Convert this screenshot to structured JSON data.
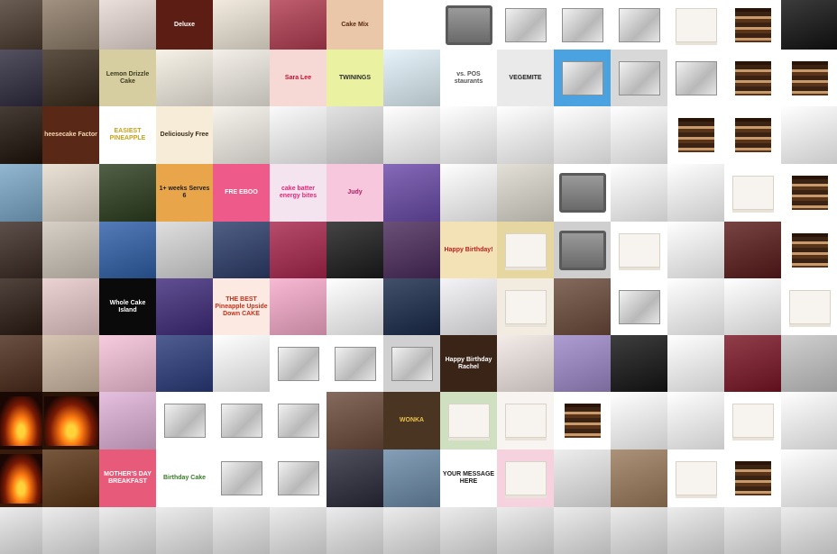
{
  "tiles": [
    {
      "bg": "#4a3a2e",
      "kind": "photo"
    },
    {
      "bg": "#8c7a66",
      "kind": "photo"
    },
    {
      "bg": "#e7d9d3",
      "kind": "photo"
    },
    {
      "bg": "#5c1e14",
      "kind": "text",
      "text": "Deluxe",
      "color": "#ffffff"
    },
    {
      "bg": "#efe6d7",
      "kind": "photo"
    },
    {
      "bg": "#b13b50",
      "kind": "photo"
    },
    {
      "bg": "#e9c7a8",
      "kind": "text",
      "text": "Cake Mix",
      "color": "#5a2a12"
    },
    {
      "bg": "#ffffff",
      "kind": "pan-outline"
    },
    {
      "bg": "#ffffff",
      "kind": "pan-square"
    },
    {
      "bg": "#ffffff",
      "kind": "pan-silver"
    },
    {
      "bg": "#ffffff",
      "kind": "pan-silver"
    },
    {
      "bg": "#ffffff",
      "kind": "pan-silver"
    },
    {
      "bg": "#ffffff",
      "kind": "cake-white"
    },
    {
      "bg": "#ffffff",
      "kind": "cake-layer"
    },
    {
      "bg": "#111111",
      "kind": "photo"
    },
    {
      "bg": "#2e2a3d",
      "kind": "photo"
    },
    {
      "bg": "#3a2b1c",
      "kind": "photo"
    },
    {
      "bg": "#d6cda0",
      "kind": "text",
      "text": "Lemon Drizzle Cake",
      "color": "#3c3c1e"
    },
    {
      "bg": "#f5efe3",
      "kind": "photo"
    },
    {
      "bg": "#f1ece4",
      "kind": "photo"
    },
    {
      "bg": "#f6d9d4",
      "kind": "text",
      "text": "Sara Lee",
      "color": "#c8102e"
    },
    {
      "bg": "#eaf2a2",
      "kind": "text",
      "text": "TWININGS",
      "color": "#2a2a2a"
    },
    {
      "bg": "#e0f0f8",
      "kind": "photo"
    },
    {
      "bg": "#ffffff",
      "kind": "text",
      "text": "vs. POS\nstaurants",
      "color": "#555555"
    },
    {
      "bg": "#eaeaea",
      "kind": "text",
      "text": "VEGEMITE",
      "color": "#222222"
    },
    {
      "bg": "#4aa3e0",
      "kind": "pan-silver"
    },
    {
      "bg": "#d8d8d8",
      "kind": "pan-silver"
    },
    {
      "bg": "#ffffff",
      "kind": "pan-silver"
    },
    {
      "bg": "#ffffff",
      "kind": "cake-layer"
    },
    {
      "bg": "#ffffff",
      "kind": "cake-layer"
    },
    {
      "bg": "#1e120a",
      "kind": "photo"
    },
    {
      "bg": "#5a2817",
      "kind": "text",
      "text": "heesecake Factor",
      "color": "#f4d7b0"
    },
    {
      "bg": "#ffffff",
      "kind": "text",
      "text": "EASIEST PINEAPPLE",
      "color": "#c8a21a"
    },
    {
      "bg": "#f6ecd7",
      "kind": "text",
      "text": "Deliciously Free",
      "color": "#3a2a1a"
    },
    {
      "bg": "#f5f1ea",
      "kind": "photo"
    },
    {
      "bg": "#f9f9f9",
      "kind": "photo"
    },
    {
      "bg": "#dcdcdc",
      "kind": "photo"
    },
    {
      "bg": "#ffffff",
      "kind": "photo"
    },
    {
      "bg": "#ffffff",
      "kind": "photo"
    },
    {
      "bg": "#ffffff",
      "kind": "photo"
    },
    {
      "bg": "#ffffff",
      "kind": "photo"
    },
    {
      "bg": "#ffffff",
      "kind": "photo"
    },
    {
      "bg": "#ffffff",
      "kind": "cake-layer"
    },
    {
      "bg": "#ffffff",
      "kind": "cake-layer"
    },
    {
      "bg": "#ffffff",
      "kind": "photo"
    },
    {
      "bg": "#7aa7c7",
      "kind": "photo"
    },
    {
      "bg": "#e6dccd",
      "kind": "photo"
    },
    {
      "bg": "#2b3d1e",
      "kind": "photo"
    },
    {
      "bg": "#e8a54a",
      "kind": "text",
      "text": "1+ weeks Serves 6",
      "color": "#222222"
    },
    {
      "bg": "#ee5a8a",
      "kind": "text",
      "text": "FRE EBOO",
      "color": "#ffffff"
    },
    {
      "bg": "#f4e4ef",
      "kind": "text",
      "text": "cake batter energy bites",
      "color": "#e8207a"
    },
    {
      "bg": "#f7c7dd",
      "kind": "text",
      "text": "Judy",
      "color": "#b01d6a"
    },
    {
      "bg": "#6a4aa8",
      "kind": "photo"
    },
    {
      "bg": "#ffffff",
      "kind": "photo"
    },
    {
      "bg": "#ddd9cf",
      "kind": "photo"
    },
    {
      "bg": "#ffffff",
      "kind": "pan-square"
    },
    {
      "bg": "#ffffff",
      "kind": "photo"
    },
    {
      "bg": "#ffffff",
      "kind": "photo"
    },
    {
      "bg": "#ffffff",
      "kind": "cake-white"
    },
    {
      "bg": "#ffffff",
      "kind": "cake-layer"
    },
    {
      "bg": "#3a2a24",
      "kind": "photo"
    },
    {
      "bg": "#cfc6bb",
      "kind": "photo"
    },
    {
      "bg": "#2f5fa8",
      "kind": "photo"
    },
    {
      "bg": "#d8d8d8",
      "kind": "photo"
    },
    {
      "bg": "#2c3c6a",
      "kind": "photo"
    },
    {
      "bg": "#a8254d",
      "kind": "photo"
    },
    {
      "bg": "#1b1b1b",
      "kind": "photo"
    },
    {
      "bg": "#4a2a5a",
      "kind": "photo"
    },
    {
      "bg": "#f3e2b5",
      "kind": "text",
      "text": "Happy Birthday!",
      "color": "#c21d1d"
    },
    {
      "bg": "#e6d7a0",
      "kind": "cake-white"
    },
    {
      "bg": "#cfcfcf",
      "kind": "pan-square"
    },
    {
      "bg": "#ffffff",
      "kind": "cake-white"
    },
    {
      "bg": "#ffffff",
      "kind": "photo"
    },
    {
      "bg": "#5a1a1a",
      "kind": "photo"
    },
    {
      "bg": "#ffffff",
      "kind": "cake-layer"
    },
    {
      "bg": "#2a1a12",
      "kind": "photo"
    },
    {
      "bg": "#e8c9c9",
      "kind": "photo"
    },
    {
      "bg": "#0a0a0a",
      "kind": "text",
      "text": "Whole Cake Island",
      "color": "#ffffff"
    },
    {
      "bg": "#3e2a7a",
      "kind": "photo"
    },
    {
      "bg": "#fbe9e2",
      "kind": "text",
      "text": "THE BEST Pineapple Upside Down CAKE",
      "color": "#c2341c"
    },
    {
      "bg": "#f6a9c9",
      "kind": "photo"
    },
    {
      "bg": "#ffffff",
      "kind": "photo"
    },
    {
      "bg": "#1a2a4a",
      "kind": "photo"
    },
    {
      "bg": "#f2f2f6",
      "kind": "photo"
    },
    {
      "bg": "#f2ece0",
      "kind": "cake-white"
    },
    {
      "bg": "#6a4a3a",
      "kind": "photo"
    },
    {
      "bg": "#ffffff",
      "kind": "pan-silver"
    },
    {
      "bg": "#ffffff",
      "kind": "photo"
    },
    {
      "bg": "#ffffff",
      "kind": "photo"
    },
    {
      "bg": "#ffffff",
      "kind": "cake-white"
    },
    {
      "bg": "#4a2a1a",
      "kind": "photo"
    },
    {
      "bg": "#cfb9a4",
      "kind": "photo"
    },
    {
      "bg": "#f5c1d8",
      "kind": "photo"
    },
    {
      "bg": "#2a3a7a",
      "kind": "photo"
    },
    {
      "bg": "#ffffff",
      "kind": "photo"
    },
    {
      "bg": "#ffffff",
      "kind": "pan-silver"
    },
    {
      "bg": "#ffffff",
      "kind": "pan-silver"
    },
    {
      "bg": "#d0d0d0",
      "kind": "pan-silver"
    },
    {
      "bg": "#3a2418",
      "kind": "text",
      "text": "Happy Birthday Rachel",
      "color": "#ffffff"
    },
    {
      "bg": "#f2e8e4",
      "kind": "photo"
    },
    {
      "bg": "#9c88c8",
      "kind": "photo"
    },
    {
      "bg": "#141414",
      "kind": "photo"
    },
    {
      "bg": "#ffffff",
      "kind": "photo"
    },
    {
      "bg": "#7a1424",
      "kind": "photo"
    },
    {
      "bg": "#c6c6c6",
      "kind": "photo"
    },
    {
      "bg": "#1a0804",
      "kind": "fire"
    },
    {
      "bg": "#2a1408",
      "kind": "fire"
    },
    {
      "bg": "#e0b2d8",
      "kind": "photo"
    },
    {
      "bg": "#ffffff",
      "kind": "pan-silver"
    },
    {
      "bg": "#ffffff",
      "kind": "pan-silver"
    },
    {
      "bg": "#ffffff",
      "kind": "pan-silver"
    },
    {
      "bg": "#6a4a3a",
      "kind": "photo"
    },
    {
      "bg": "#4a3422",
      "kind": "text",
      "text": "WONKA",
      "color": "#e9c14a"
    },
    {
      "bg": "#cfe0c0",
      "kind": "cake-white"
    },
    {
      "bg": "#f8f4f2",
      "kind": "cake-white"
    },
    {
      "bg": "#ffffff",
      "kind": "cake-layer"
    },
    {
      "bg": "#ffffff",
      "kind": "photo"
    },
    {
      "bg": "#ffffff",
      "kind": "photo"
    },
    {
      "bg": "#ffffff",
      "kind": "cake-white"
    },
    {
      "bg": "#ffffff",
      "kind": "photo"
    },
    {
      "bg": "#3a1a0a",
      "kind": "fire"
    },
    {
      "bg": "#5a3414",
      "kind": "photo"
    },
    {
      "bg": "#e85a7a",
      "kind": "text",
      "text": "MOTHER'S DAY BREAKFAST",
      "color": "#ffffff"
    },
    {
      "bg": "#ffffff",
      "kind": "text",
      "text": "Birthday Cake",
      "color": "#3a7a2a"
    },
    {
      "bg": "#ffffff",
      "kind": "pan-silver"
    },
    {
      "bg": "#ffffff",
      "kind": "pan-silver"
    },
    {
      "bg": "#2a2a3a",
      "kind": "photo"
    },
    {
      "bg": "#6a8aa8",
      "kind": "photo"
    },
    {
      "bg": "#ffffff",
      "kind": "text",
      "text": "YOUR MESSAGE HERE",
      "color": "#1a1a1a"
    },
    {
      "bg": "#f6d2de",
      "kind": "cake-white"
    },
    {
      "bg": "#eaeaea",
      "kind": "photo"
    },
    {
      "bg": "#9a7a5a",
      "kind": "photo"
    },
    {
      "bg": "#ffffff",
      "kind": "cake-white"
    },
    {
      "bg": "#ffffff",
      "kind": "cake-layer"
    },
    {
      "bg": "#ffffff",
      "kind": "photo"
    }
  ]
}
